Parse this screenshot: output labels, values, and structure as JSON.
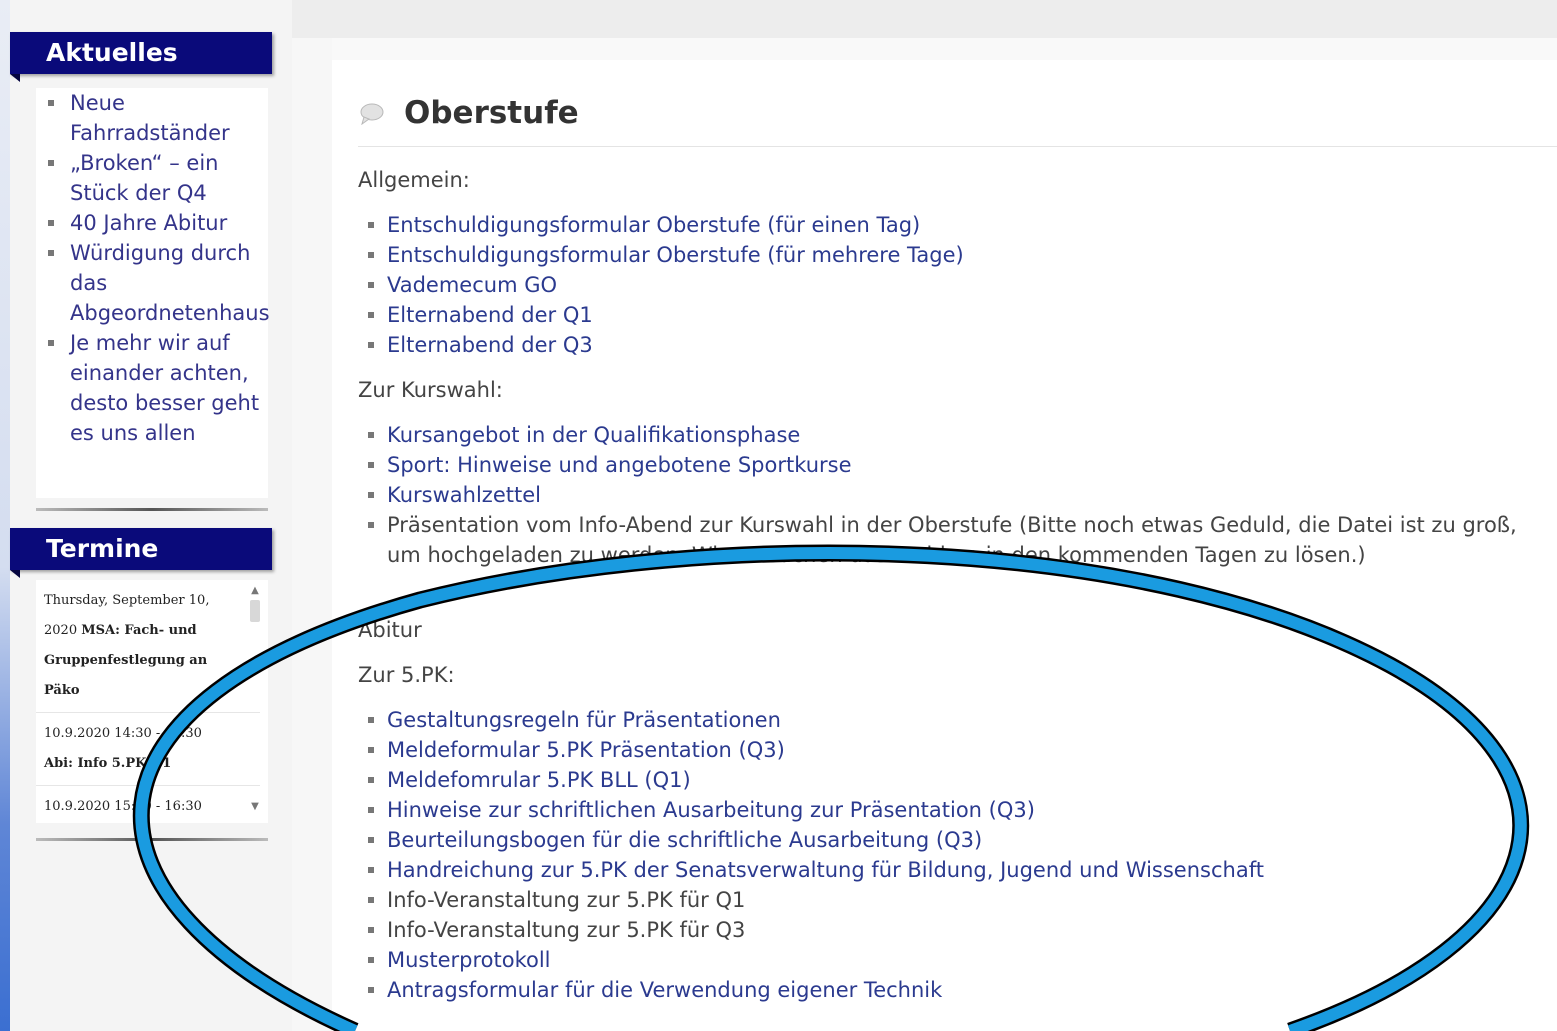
{
  "sidebar": {
    "aktuelles": {
      "title": "Aktuelles",
      "items": [
        {
          "label": "Neue Fahrradständer"
        },
        {
          "label": "„Broken“ – ein Stück der Q4"
        },
        {
          "label": "40 Jahre Abitur"
        },
        {
          "label": "Würdigung durch das Abgeordnetenhaus"
        },
        {
          "label": "Je mehr wir auf einander achten, desto besser geht es uns allen"
        }
      ]
    },
    "termine": {
      "title": "Termine",
      "events": [
        {
          "date": "Thursday, September 10, 2020",
          "title": "MSA: Fach- und Gruppenfestlegung an Päko"
        },
        {
          "date": "10.9.2020 14:30 - 15:30",
          "title": "Abi: Info 5.PK Q1"
        },
        {
          "date": "10.9.2020 15:30 - 16:30",
          "title": ""
        }
      ]
    }
  },
  "main": {
    "title": "Oberstufe",
    "allgemein": {
      "label": "Allgemein:",
      "items": [
        "Entschuldigungsformular Oberstufe (für einen Tag)",
        "Entschuldigungsformular Oberstufe (für mehrere Tage)",
        "Vademecum GO",
        "Elternabend der Q1",
        "Elternabend der Q3"
      ]
    },
    "kurswahl": {
      "label": "Zur Kurswahl:",
      "items": [
        "Kursangebot in der Qualifikationsphase",
        "Sport: Hinweise und angebotene Sportkurse",
        "Kurswahlzettel",
        "Präsentation vom Info-Abend zur Kurswahl in der Oberstufe (Bitte noch etwas Geduld, die Datei ist zu groß, um hochgeladen zu werden. Wir versuchen das Problem in den kommenden Tagen zu lösen.)"
      ]
    },
    "abitur_label": "Abitur",
    "pk5": {
      "label": "Zur 5.PK:",
      "items": [
        "Gestaltungsregeln für Präsentationen",
        "Meldeformular 5.PK Präsentation (Q3)",
        "Meldefomrular 5.PK BLL (Q1)",
        "Hinweise zur schriftlichen Ausarbeitung zur Präsentation (Q3)",
        "Beurteilungsbogen für die schriftliche Ausarbeitung (Q3)",
        "Handreichung zur 5.PK der Senatsverwaltung für Bildung, Jugend und Wissenschaft"
      ],
      "plain_items": [
        "Info-Veranstaltung zur 5.PK für Q1",
        "Info-Veranstaltung zur 5.PK für Q3"
      ],
      "more_items": [
        "Musterprotokoll",
        "Antragsformular für die Verwendung eigener Technik"
      ]
    }
  },
  "annotation": {
    "color": "#1a9be0"
  }
}
